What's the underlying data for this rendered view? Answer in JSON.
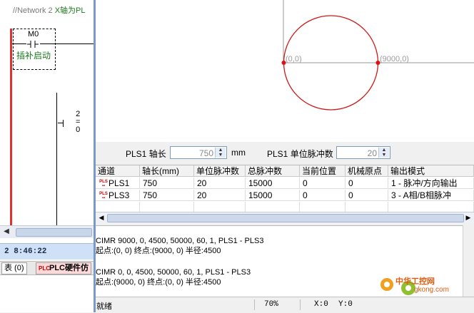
{
  "ladder": {
    "comment": "//Network 2",
    "comment_tail": "X轴为PL",
    "contact_name": "M0",
    "contact_label": "插补启动",
    "compare_top": "2",
    "compare_mid": "=",
    "compare_bot": "0",
    "time": "2 8:46:22",
    "tabs": [
      "表 (0)",
      "PLC硬件仿"
    ]
  },
  "plot": {
    "point_start_label": "(0,0)",
    "point_end_label": "(9000,0)",
    "circle_color": "#cc1a1a",
    "axis_color": "#9a9a9a"
  },
  "settings": {
    "axis_length_label": "PLS1 轴长",
    "axis_length_value": "750",
    "axis_length_unit": "mm",
    "pulses_label": "PLS1 单位脉冲数",
    "pulses_value": "20"
  },
  "table": {
    "headers": [
      "通道",
      "轴长(mm)",
      "单位脉冲数",
      "总脉冲数",
      "当前位置",
      "机械原点",
      "输出模式"
    ],
    "rows": [
      [
        "PLS1",
        "750",
        "20",
        "15000",
        "0",
        "0",
        "1 - 脉冲/方向输出"
      ],
      [
        "PLS3",
        "750",
        "20",
        "15000",
        "0",
        "0",
        "3 - A相/B相脉冲"
      ]
    ]
  },
  "log": {
    "lines": [
      "CIMR  9000, 0, 4500, 50000, 60, 1, PLS1 - PLS3",
      "起点:(0, 0)    终点:(9000, 0)    半径:4500",
      "CIMR  0, 0, 4500, 50000, 60, 1, PLS1 - PLS3",
      "起点:(9000, 0)    终点:(0, 0)    半径:4500"
    ]
  },
  "status": {
    "ready": "就绪",
    "zoom": "70%",
    "x": "X:0",
    "y": "Y:0"
  },
  "watermark": {
    "brand": "中华工控网",
    "domain": "gkong.com"
  }
}
